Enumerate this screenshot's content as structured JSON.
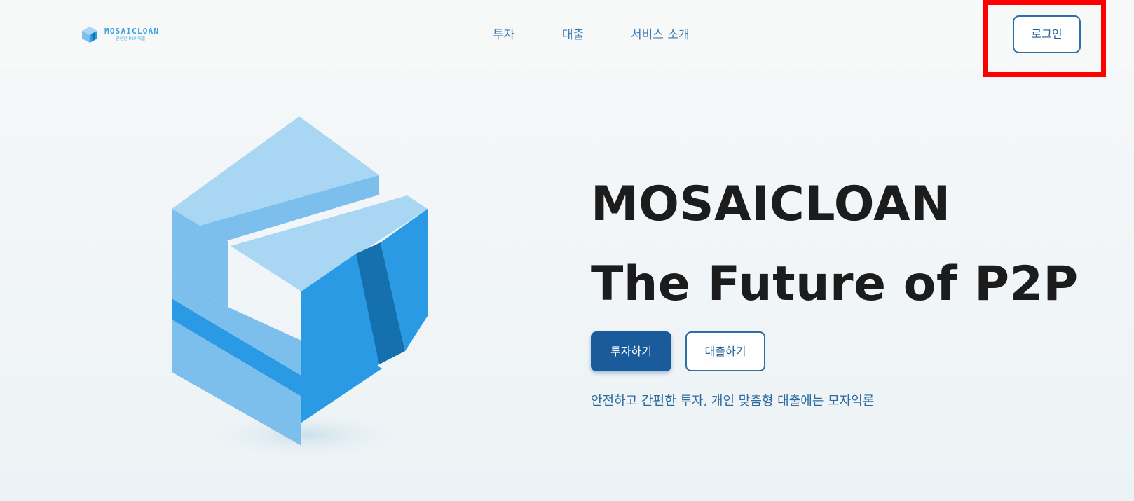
{
  "header": {
    "logo": {
      "name": "MOSAICLOAN",
      "tagline": "안전한 P2P 대출"
    },
    "nav": [
      {
        "label": "투자"
      },
      {
        "label": "대출"
      },
      {
        "label": "서비스 소개"
      }
    ],
    "login_label": "로그인"
  },
  "hero": {
    "title_line1": "MOSAICLOAN",
    "title_line2": "The Future of P2P",
    "primary_button": "투자하기",
    "secondary_button": "대출하기",
    "subtitle": "안전하고 간편한 투자, 개인 맞춤형 대출에는 모자익론"
  },
  "colors": {
    "brand_blue": "#2a9ae4",
    "dark_blue": "#1a5b9b",
    "highlight": "#ff0000"
  },
  "annotation": {
    "highlighted_element": "login-button"
  }
}
